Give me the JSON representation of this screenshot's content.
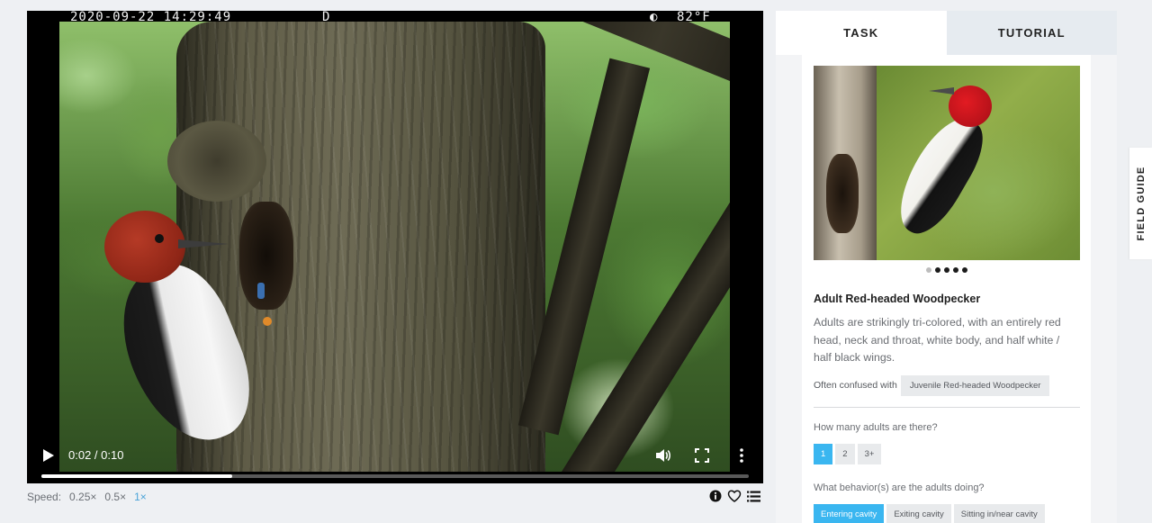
{
  "video": {
    "overlay": {
      "timestamp": "2020-09-22 14:29:49",
      "mode": "D",
      "temperature_icon": "◐",
      "temperature": "82°F"
    },
    "time_display": "0:02 / 0:10",
    "progress_fraction": 0.27,
    "icons": {
      "play": "play-icon",
      "volume": "volume-icon",
      "fullscreen": "fullscreen-icon",
      "more": "more-vertical-icon"
    }
  },
  "speed": {
    "label": "Speed:",
    "options": [
      {
        "label": "0.25×",
        "active": false
      },
      {
        "label": "0.5×",
        "active": false
      },
      {
        "label": "1×",
        "active": true
      }
    ]
  },
  "utility_icons": [
    "info-icon",
    "heart-icon",
    "list-icon"
  ],
  "panel": {
    "tabs": [
      {
        "label": "TASK",
        "active": true
      },
      {
        "label": "TUTORIAL",
        "active": false
      }
    ],
    "species": {
      "name": "Adult Red-headed Woodpecker",
      "description": "Adults are strikingly tri-colored, with an entirely red head, neck and throat, white body, and half white / half black wings.",
      "confused_label": "Often confused with",
      "confused_with": "Juvenile Red-headed Woodpecker",
      "image_dots": 5,
      "active_dot": 0
    },
    "questions": [
      {
        "text": "How many adults are there?",
        "options": [
          {
            "label": "1",
            "selected": true
          },
          {
            "label": "2",
            "selected": false
          },
          {
            "label": "3+",
            "selected": false
          }
        ]
      },
      {
        "text": "What behavior(s) are the adults doing?",
        "options": [
          {
            "label": "Entering cavity",
            "selected": true
          },
          {
            "label": "Exiting cavity",
            "selected": false
          },
          {
            "label": "Sitting in/near cavity",
            "selected": false
          }
        ]
      }
    ]
  },
  "field_guide": {
    "label": "FIELD GUIDE"
  },
  "colors": {
    "accent": "#3ab6f0",
    "speed_active": "#4aa3d8",
    "page_bg": "#eef0f3"
  }
}
